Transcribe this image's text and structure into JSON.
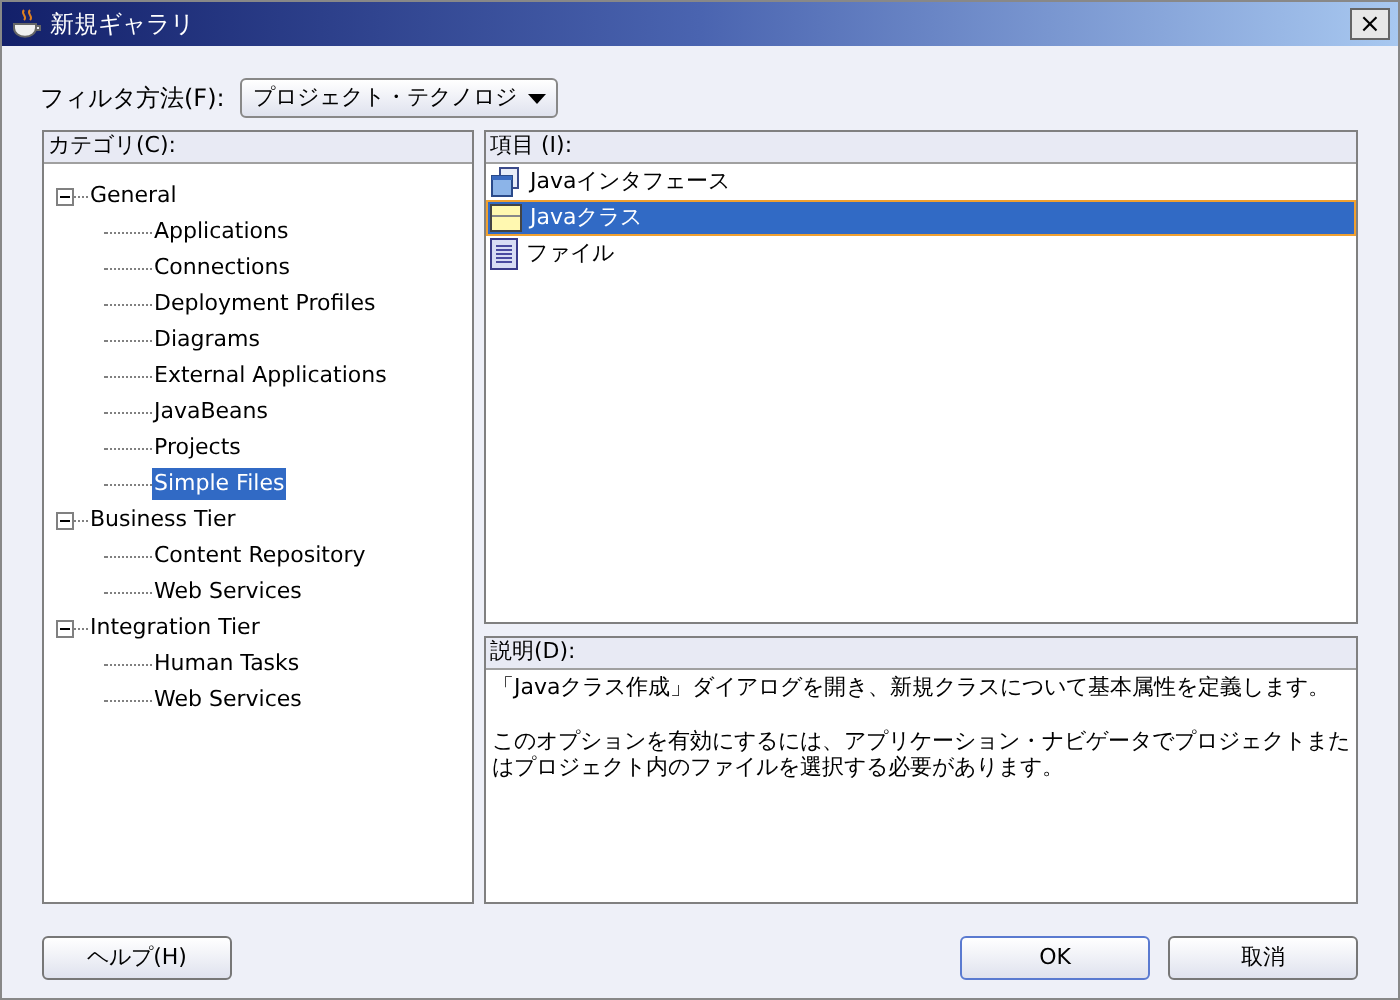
{
  "window": {
    "title": "新規ギャラリ",
    "close": "×"
  },
  "filter": {
    "label": "フィルタ方法(F):",
    "value": "プロジェクト・テクノロジ"
  },
  "categories": {
    "label": "カテゴリ(C):",
    "tree": [
      {
        "label": "General",
        "expanded": true,
        "selected": false,
        "children": [
          {
            "label": "Applications",
            "selected": false
          },
          {
            "label": "Connections",
            "selected": false
          },
          {
            "label": "Deployment Profiles",
            "selected": false
          },
          {
            "label": "Diagrams",
            "selected": false
          },
          {
            "label": "External Applications",
            "selected": false
          },
          {
            "label": "JavaBeans",
            "selected": false
          },
          {
            "label": "Projects",
            "selected": false
          },
          {
            "label": "Simple Files",
            "selected": true
          }
        ]
      },
      {
        "label": "Business Tier",
        "expanded": true,
        "selected": false,
        "children": [
          {
            "label": "Content Repository",
            "selected": false
          },
          {
            "label": "Web Services",
            "selected": false
          }
        ]
      },
      {
        "label": "Integration Tier",
        "expanded": true,
        "selected": false,
        "children": [
          {
            "label": "Human Tasks",
            "selected": false
          },
          {
            "label": "Web Services",
            "selected": false
          }
        ]
      }
    ]
  },
  "items": {
    "label": "項目 (I):",
    "list": [
      {
        "label": "Javaインタフェース",
        "kind": "interface",
        "selected": false
      },
      {
        "label": "Javaクラス",
        "kind": "class",
        "selected": true
      },
      {
        "label": "ファイル",
        "kind": "file",
        "selected": false
      }
    ]
  },
  "description": {
    "label": "説明(D):",
    "paragraphs": [
      "「Javaクラス作成」ダイアログを開き、新規クラスについて基本属性を定義します。",
      "このオプションを有効にするには、アプリケーション・ナビゲータでプロジェクトまたはプロジェクト内のファイルを選択する必要があります。"
    ]
  },
  "buttons": {
    "help": "ヘルプ(H)",
    "ok": "OK",
    "cancel": "取消"
  }
}
